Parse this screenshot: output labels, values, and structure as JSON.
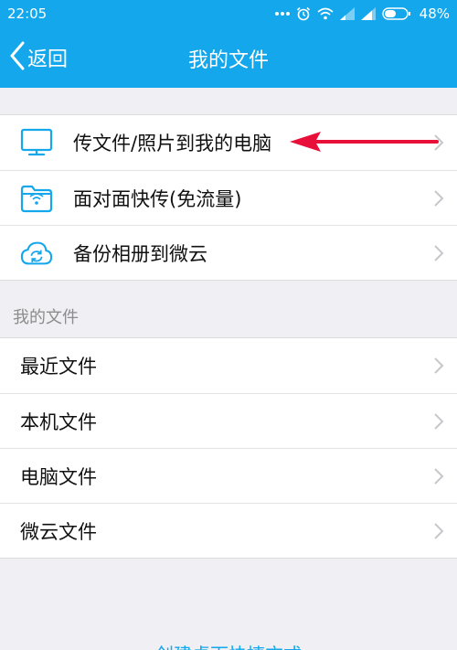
{
  "status_bar": {
    "time": "22:05",
    "icons": [
      "more-dots-icon",
      "alarm-icon",
      "wifi-icon",
      "signal-icon",
      "signal-icon",
      "battery-icon"
    ],
    "battery": "48%"
  },
  "header": {
    "back_label": "返回",
    "title": "我的文件"
  },
  "transfer_items": [
    {
      "label": "传文件/照片到我的电脑",
      "icon": "monitor-icon"
    },
    {
      "label": "面对面快传(免流量)",
      "icon": "wireless-folder-icon"
    },
    {
      "label": "备份相册到微云",
      "icon": "cloud-sync-icon"
    }
  ],
  "files_section": {
    "header": "我的文件",
    "items": [
      {
        "label": "最近文件"
      },
      {
        "label": "本机文件"
      },
      {
        "label": "电脑文件"
      },
      {
        "label": "微云文件"
      }
    ]
  },
  "bottom_link": "创建桌面快捷方式",
  "colors": {
    "brand_blue": "#14a7eb",
    "annotation_red": "#e8103a",
    "background": "#efeff4"
  }
}
